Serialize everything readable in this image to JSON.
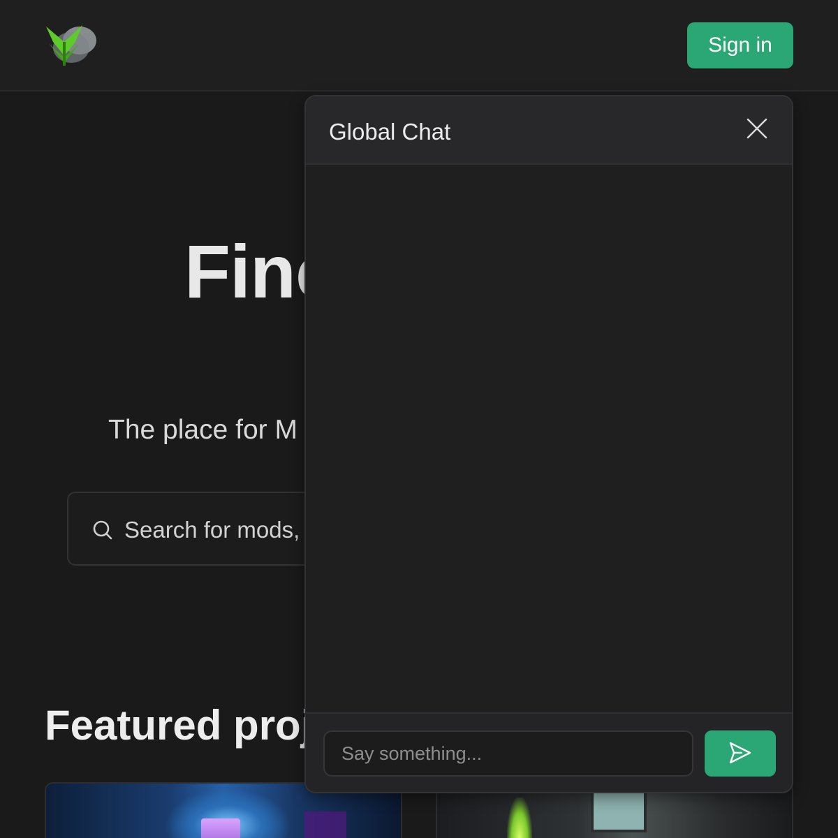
{
  "header": {
    "logo_icon": "modrinth-style-logo-icon",
    "signin_label": "Sign in",
    "accent_color": "#2aa775"
  },
  "hero": {
    "title_visible": "Finc",
    "subtitle_visible": "The place for M"
  },
  "search": {
    "icon": "search-icon",
    "placeholder_visible": "Search for mods, p"
  },
  "featured": {
    "heading_visible": "Featured proj"
  },
  "chat": {
    "title": "Global Chat",
    "close_icon": "close-icon",
    "input_placeholder": "Say something...",
    "send_icon": "send-icon",
    "messages": []
  }
}
